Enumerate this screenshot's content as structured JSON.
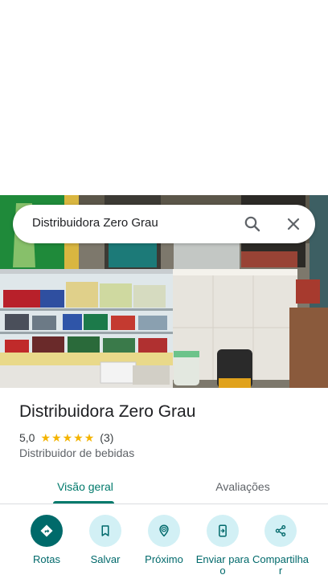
{
  "search": {
    "query": "Distribuidora Zero Grau"
  },
  "place": {
    "name": "Distribuidora Zero Grau",
    "rating": "5,0",
    "stars": 5,
    "review_count": "(3)",
    "category": "Distribuidor de bebidas"
  },
  "tabs": [
    {
      "label": "Visão geral",
      "active": true
    },
    {
      "label": "Avaliações",
      "active": false
    }
  ],
  "actions": [
    {
      "label": "Rotas",
      "icon": "directions-icon"
    },
    {
      "label": "Salvar",
      "icon": "bookmark-icon"
    },
    {
      "label": "Próximo",
      "icon": "nearby-icon"
    },
    {
      "label": "Enviar para o",
      "icon": "send-to-phone-icon"
    },
    {
      "label": "Compartilhar",
      "icon": "share-icon"
    }
  ],
  "colors": {
    "accent": "#00796b",
    "action_bg": "#d2f0f5",
    "primary_action_bg": "#006a6a",
    "star": "#f4b400"
  }
}
